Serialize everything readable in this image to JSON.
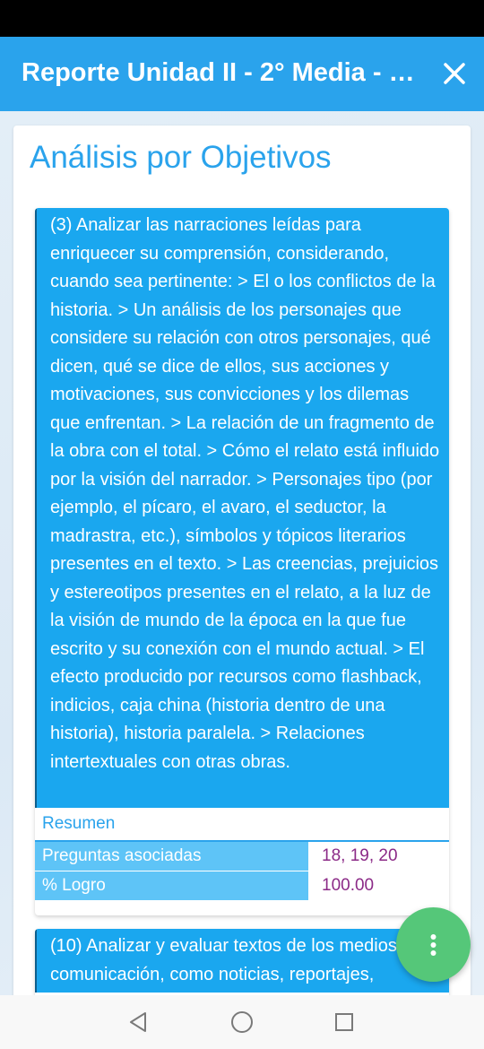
{
  "app_bar": {
    "title": "Reporte Unidad II - 2° Media - L...",
    "close_icon": "close-icon"
  },
  "section_title": "Análisis por Objetivos",
  "objectives": [
    {
      "text": "(3) Analizar las narraciones leídas para enriquecer su comprensión, considerando, cuando sea pertinente: > El o los conflictos de la historia. > Un análisis de los personajes que considere su relación con otros personajes, qué dicen, qué se dice de ellos, sus acciones y motivaciones, sus convicciones y los dilemas que enfrentan. > La relación de un fragmento de la obra con el total. > Cómo el relato está influido por la visión del narrador. > Personajes tipo (por ejemplo, el pícaro, el avaro, el seductor, la madrastra, etc.), símbolos y tópicos literarios presentes en el texto. > Las creencias, prejuicios y estereotipos presentes en el relato, a la luz de la visión de mundo de la época en la que fue escrito y su conexión con el mundo actual. > El efecto producido por recursos como flashback, indicios, caja china (historia dentro de una historia), historia paralela. > Relaciones intertextuales con otras obras.",
      "summary_label": "Resumen",
      "stats": [
        {
          "label": "Preguntas asociadas",
          "value": "18, 19, 20"
        },
        {
          "label": "% Logro",
          "value": "100.00"
        }
      ]
    },
    {
      "text": "(10) Analizar y evaluar textos de los medios de comunicación, como noticias, reportajes,"
    }
  ],
  "fab": {
    "icon": "more-vertical-icon"
  },
  "nav": {
    "back_icon": "back-triangle-icon",
    "home_icon": "home-circle-icon",
    "recents_icon": "recents-square-icon"
  },
  "colors": {
    "primary": "#2aa3ec",
    "objective_bg": "#1aa7ef",
    "value_text": "#8b2a87",
    "fab": "#55c779"
  }
}
